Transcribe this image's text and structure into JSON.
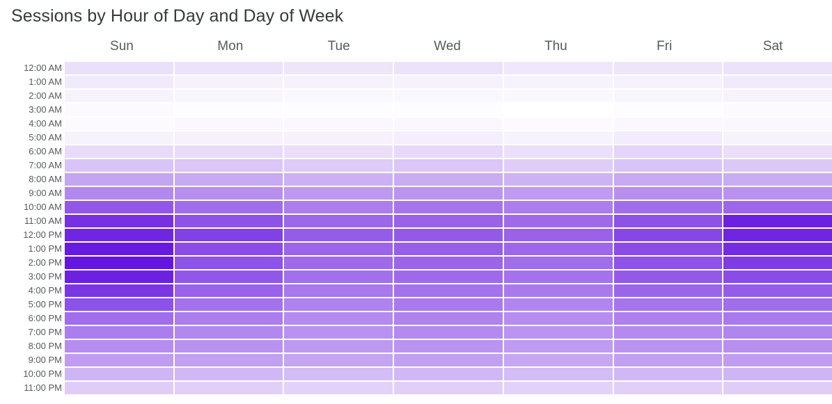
{
  "chart_title": "Sessions by Hour of Day and Day of Week",
  "colors": {
    "title_text": "#36393d",
    "axis_label_text": "#56595c",
    "background": "#ffffff",
    "scale_min": "#ffffff",
    "scale_max": "#5500dd",
    "accent": "#7b2ff2"
  },
  "chart_data": {
    "type": "heatmap",
    "title": "Sessions by Hour of Day and Day of Week",
    "xlabel": "",
    "ylabel": "",
    "grid": false,
    "legend": "none",
    "x_categories": [
      "Sun",
      "Mon",
      "Tue",
      "Wed",
      "Thu",
      "Fri",
      "Sat"
    ],
    "y_categories": [
      "12:00 AM",
      "1:00 AM",
      "2:00 AM",
      "3:00 AM",
      "4:00 AM",
      "5:00 AM",
      "6:00 AM",
      "7:00 AM",
      "8:00 AM",
      "9:00 AM",
      "10:00 AM",
      "11:00 AM",
      "12:00 PM",
      "1:00 PM",
      "2:00 PM",
      "3:00 PM",
      "4:00 PM",
      "5:00 PM",
      "6:00 PM",
      "7:00 PM",
      "8:00 PM",
      "9:00 PM",
      "10:00 PM",
      "11:00 PM"
    ],
    "value_range": [
      0,
      100
    ],
    "colorscale": [
      [
        0.0,
        "#ffffff"
      ],
      [
        0.5,
        "#b388ee"
      ],
      [
        1.0,
        "#5500dd"
      ]
    ],
    "rows": [
      {
        "hour": "12:00 AM",
        "values": [
          13,
          12,
          11,
          12,
          10,
          11,
          12
        ]
      },
      {
        "hour": "1:00 AM",
        "values": [
          9,
          6,
          6,
          6,
          5,
          6,
          9
        ]
      },
      {
        "hour": "2:00 AM",
        "values": [
          5,
          4,
          3,
          3,
          3,
          4,
          5
        ]
      },
      {
        "hour": "3:00 AM",
        "values": [
          2,
          1,
          1,
          1,
          0,
          1,
          2
        ]
      },
      {
        "hour": "4:00 AM",
        "values": [
          2,
          3,
          3,
          3,
          2,
          3,
          3
        ]
      },
      {
        "hour": "5:00 AM",
        "values": [
          5,
          6,
          6,
          7,
          5,
          8,
          5
        ]
      },
      {
        "hour": "6:00 AM",
        "values": [
          15,
          15,
          14,
          16,
          13,
          18,
          14
        ]
      },
      {
        "hour": "7:00 AM",
        "values": [
          25,
          24,
          22,
          24,
          21,
          25,
          23
        ]
      },
      {
        "hour": "8:00 AM",
        "values": [
          38,
          36,
          33,
          35,
          32,
          36,
          35
        ]
      },
      {
        "hour": "9:00 AM",
        "values": [
          50,
          47,
          43,
          45,
          42,
          47,
          46
        ]
      },
      {
        "hour": "10:00 AM",
        "values": [
          68,
          60,
          54,
          57,
          54,
          60,
          62
        ]
      },
      {
        "hour": "11:00 AM",
        "values": [
          82,
          70,
          62,
          64,
          61,
          70,
          88
        ]
      },
      {
        "hour": "12:00 PM",
        "values": [
          86,
          76,
          66,
          67,
          64,
          74,
          86
        ]
      },
      {
        "hour": "1:00 PM",
        "values": [
          90,
          72,
          63,
          65,
          62,
          72,
          84
        ]
      },
      {
        "hour": "2:00 PM",
        "values": [
          92,
          70,
          61,
          63,
          60,
          70,
          78
        ]
      },
      {
        "hour": "3:00 PM",
        "values": [
          88,
          68,
          59,
          61,
          58,
          67,
          72
        ]
      },
      {
        "hour": "4:00 PM",
        "values": [
          80,
          64,
          56,
          58,
          55,
          63,
          66
        ]
      },
      {
        "hour": "5:00 PM",
        "values": [
          70,
          58,
          52,
          55,
          51,
          57,
          60
        ]
      },
      {
        "hour": "6:00 PM",
        "values": [
          60,
          54,
          49,
          52,
          48,
          53,
          55
        ]
      },
      {
        "hour": "7:00 PM",
        "values": [
          54,
          50,
          46,
          49,
          45,
          49,
          51
        ]
      },
      {
        "hour": "8:00 PM",
        "values": [
          48,
          46,
          43,
          45,
          42,
          45,
          47
        ]
      },
      {
        "hour": "9:00 PM",
        "values": [
          41,
          40,
          38,
          40,
          37,
          40,
          41
        ]
      },
      {
        "hour": "10:00 PM",
        "values": [
          31,
          30,
          28,
          30,
          28,
          30,
          31
        ]
      },
      {
        "hour": "11:00 PM",
        "values": [
          21,
          20,
          19,
          20,
          19,
          20,
          21
        ]
      }
    ]
  }
}
